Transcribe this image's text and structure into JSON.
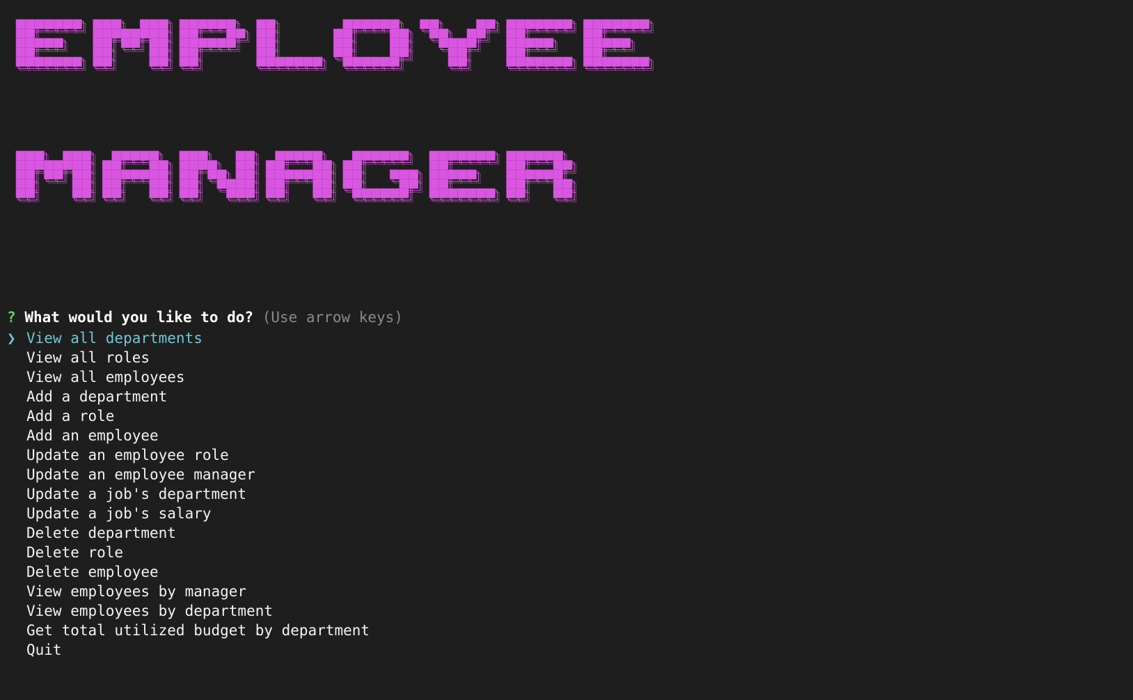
{
  "banner": {
    "lines": [
      "EMPLOYEE",
      "MANAGER"
    ],
    "color": "#d957e0",
    "border_color": "#d957e0"
  },
  "prompt": {
    "marker": "?",
    "question": "What would you like to do?",
    "hint": "(Use arrow keys)"
  },
  "pointer_glyph": "❯",
  "selected_index": 0,
  "menu": [
    "View all departments",
    "View all roles",
    "View all employees",
    "Add a department",
    "Add a role",
    "Add an employee",
    "Update an employee role",
    "Update an employee manager",
    "Update a job's department",
    "Update a job's salary",
    "Delete department",
    "Delete role",
    "Delete employee",
    "View employees by manager",
    "View employees by department",
    "Get total utilized budget by department",
    "Quit"
  ]
}
